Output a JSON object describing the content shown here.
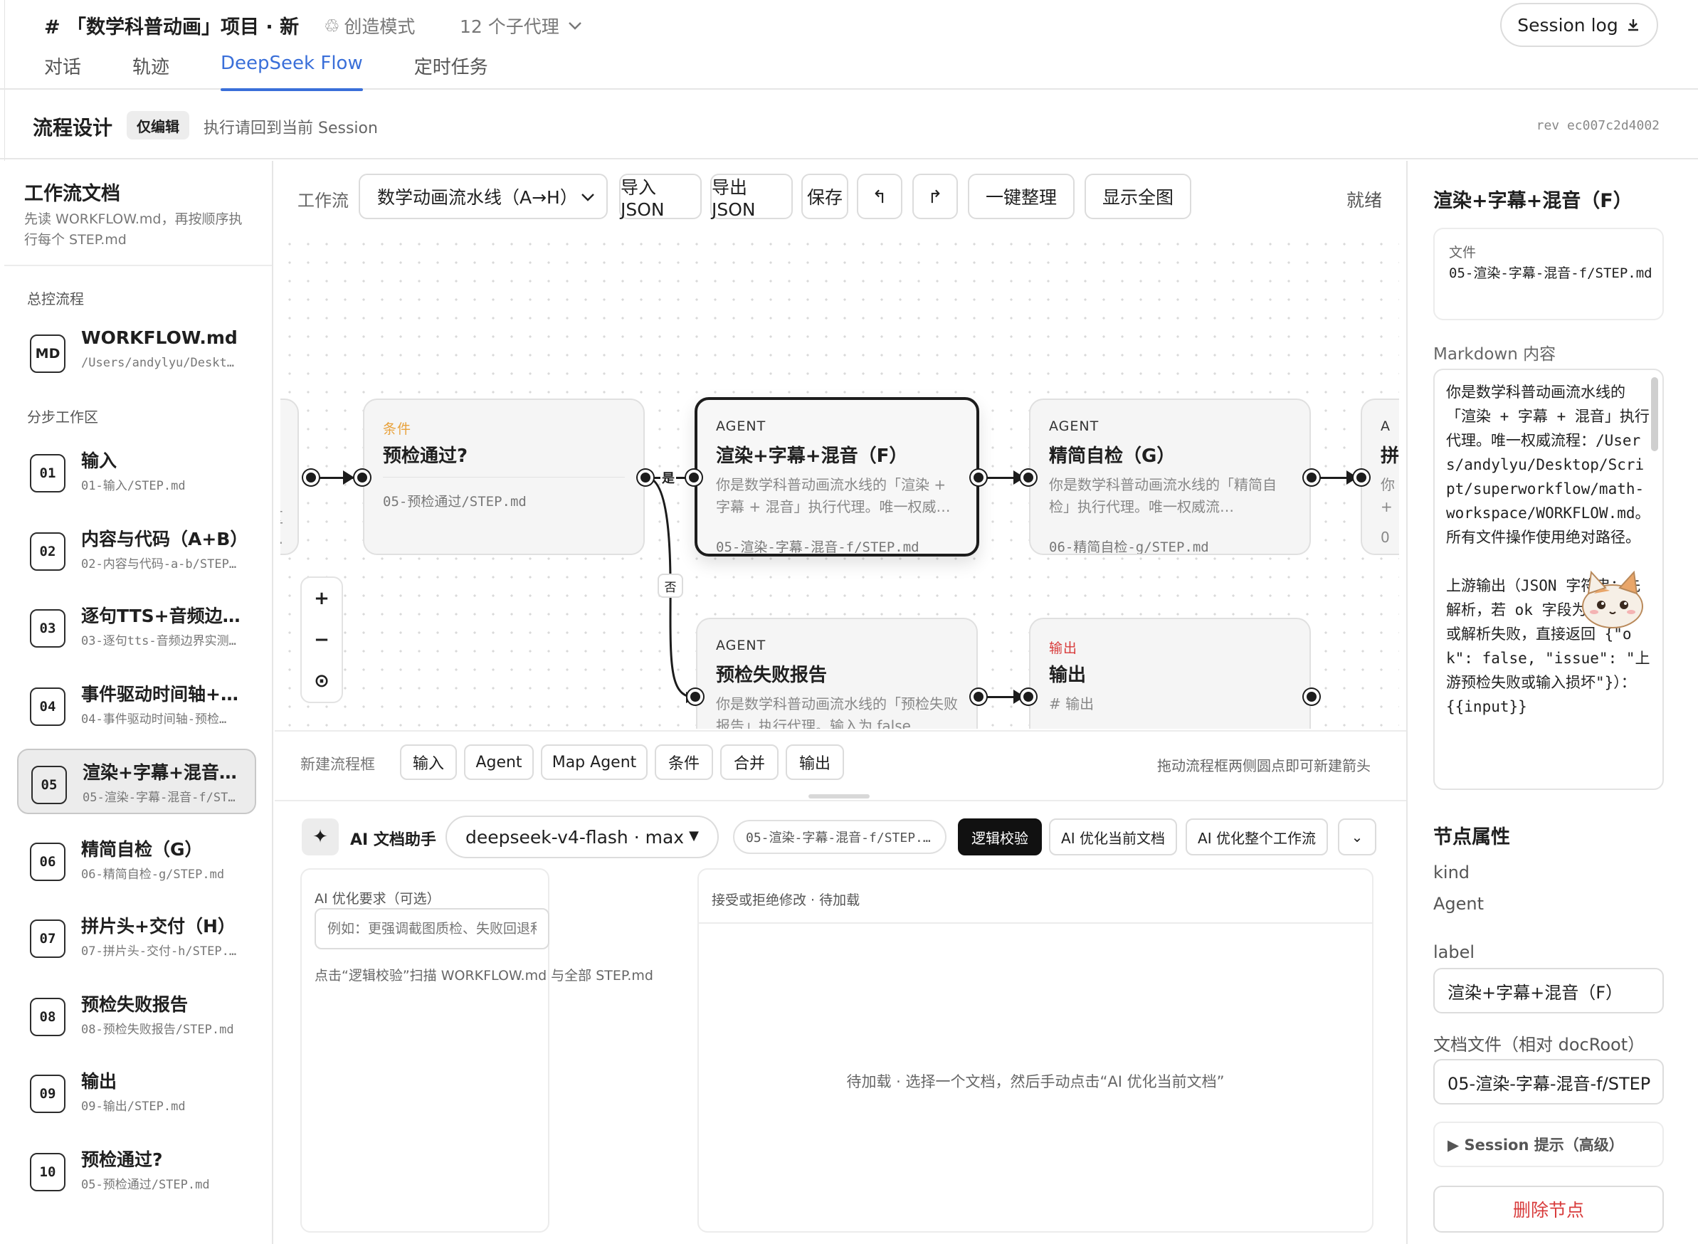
{
  "header": {
    "project_title": "#  「数学科普动画」项目 · 新",
    "mode": "创造模式",
    "agents": "12 个子代理",
    "tabs": [
      {
        "label": "对话"
      },
      {
        "label": "轨迹"
      },
      {
        "label": "DeepSeek Flow",
        "active": true
      },
      {
        "label": "定时任务"
      }
    ],
    "session_log": "Session log"
  },
  "design_bar": {
    "title": "流程设计",
    "badge": "仅编辑",
    "hint": "执行请回到当前 Session",
    "rev": "rev ec007c2d4002"
  },
  "left": {
    "title": "工作流文档",
    "desc": "先读 WORKFLOW.md，再按顺序执行每个 STEP.md",
    "section_master": "总控流程",
    "master": {
      "badge": "MD",
      "name": "WORKFLOW.md",
      "path": "/Users/andylyu/Deskt…"
    },
    "section_steps": "分步工作区",
    "steps": [
      {
        "num": "01",
        "name": "输入",
        "path": "01-输入/STEP.md"
      },
      {
        "num": "02",
        "name": "内容与代码（A+B）",
        "path": "02-内容与代码-a-b/STEP…"
      },
      {
        "num": "03",
        "name": "逐句TTS+音频边界…",
        "path": "03-逐句tts-音频边界实测…"
      },
      {
        "num": "04",
        "name": "事件驱动时间轴+预…",
        "path": "04-事件驱动时间轴-预检…"
      },
      {
        "num": "05",
        "name": "渲染+字幕+混音（…",
        "path": "05-渲染-字幕-混音-f/ST…",
        "active": true
      },
      {
        "num": "06",
        "name": "精简自检（G）",
        "path": "06-精简自检-g/STEP.md"
      },
      {
        "num": "07",
        "name": "拼片头+交付（H）",
        "path": "07-拼片头-交付-h/STEP.…"
      },
      {
        "num": "08",
        "name": "预检失败报告",
        "path": "08-预检失败报告/STEP.md"
      },
      {
        "num": "09",
        "name": "输出",
        "path": "09-输出/STEP.md"
      },
      {
        "num": "10",
        "name": "预检通过?",
        "path": "05-预检通过/STEP.md"
      }
    ]
  },
  "toolbar": {
    "label": "工作流",
    "workflow": "数学动画流水线（A→H）",
    "import": "导入 JSON",
    "export": "导出 JSON",
    "save": "保存",
    "undo": "↰",
    "redo": "↱",
    "arrange": "一键整理",
    "fit": "显示全图",
    "status": "就绪"
  },
  "canvas": {
    "edge_yes": "是",
    "edge_no": "否",
    "left_stub_lines": [
      "区",
      "…"
    ],
    "right_stub_kind": "A",
    "right_stub_title": "拼",
    "right_stub_lines": [
      "你",
      "+",
      "0"
    ],
    "nodes": {
      "cond": {
        "kind": "条件",
        "title": "预检通过?",
        "path": "05-预检通过/STEP.md"
      },
      "render": {
        "kind": "AGENT",
        "title": "渲染+字幕+混音（F）",
        "desc": "你是数学科普动画流水线的「渲染 + 字幕 + 混音」执行代理。唯一权威…",
        "path": "05-渲染-字幕-混音-f/STEP.md"
      },
      "check": {
        "kind": "AGENT",
        "title": "精简自检（G）",
        "desc": "你是数学科普动画流水线的「精简自检」执行代理。唯一权威流…",
        "path": "06-精简自检-g/STEP.md"
      },
      "fail": {
        "kind": "AGENT",
        "title": "预检失败报告",
        "desc": "你是数学科普动画流水线的「预检失败报告」执行代理。输入为 false…"
      },
      "out": {
        "kind": "输出",
        "title": "输出",
        "desc": "# 输出",
        "more": "…"
      }
    },
    "zoom_in": "+",
    "zoom_out": "−",
    "zoom_fit": "⊙"
  },
  "newbar": {
    "label": "新建流程框",
    "buttons": [
      "输入",
      "Agent",
      "Map Agent",
      "条件",
      "合并",
      "输出"
    ],
    "hint": "拖动流程框两侧圆点即可新建箭头"
  },
  "ai": {
    "icon": "✦",
    "title": "AI 文档助手",
    "model": "deepseek-v4-flash · max",
    "doc": "05-渲染-字幕-混音-f/STEP.…",
    "logic_check": "逻辑校验",
    "optimize_doc": "AI 优化当前文档",
    "optimize_flow": "AI 优化整个工作流",
    "more": "⌄",
    "req_label": "AI 优化要求（可选）",
    "req_placeholder": "例如：更强调截图质检、失败回退和交付文件",
    "scan_hint": "点击“逻辑校验”扫描 WORKFLOW.md 与全部 STEP.md",
    "review_title": "接受或拒绝修改 · 待加载",
    "review_empty": "待加载 · 选择一个文档，然后手动点击“AI 优化当前文档”"
  },
  "right": {
    "title": "渲染+字幕+混音（F）",
    "file_label": "文件",
    "file_value": "05-渲染-字幕-混音-f/STEP.md",
    "md_label": "Markdown 内容",
    "md_content": "你是数学科普动画流水线的「渲染 + 字幕 + 混音」执行代理。唯一权威流程：/Users/andylyu/Desktop/Script/superworkflow/math-workspace/WORKFLOW.md。所有文件操作使用绝对路径。\n\n上游输出（JSON 字符串；先解析，若 ok 字段为 false 或解析失败，直接返回 {\"ok\": false, \"issue\": \"上游预检失败或输入损坏\"}）：{{input}}",
    "props_title": "节点属性",
    "kind_label": "kind",
    "kind_value": "Agent",
    "label_label": "label",
    "label_value": "渲染+字幕+混音（F）",
    "doc_label": "文档文件（相对 docRoot）",
    "doc_value": "05-渲染-字幕-混音-f/STEP",
    "session_hint": "▶ Session 提示（高级）",
    "delete": "删除节点"
  },
  "colors": {
    "accent": "#3a6fd9",
    "condition": "#e8a23c",
    "output": "#d83b3b",
    "danger": "#d83b3b"
  }
}
